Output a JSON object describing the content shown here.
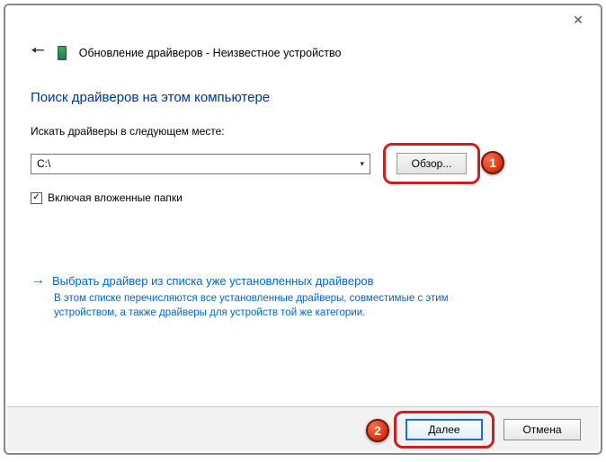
{
  "window": {
    "title": "Обновление драйверов - Неизвестное устройство"
  },
  "heading": "Поиск драйверов на этом компьютере",
  "form": {
    "search_label": "Искать драйверы в следующем месте:",
    "path_value": "C:\\",
    "browse_label": "Обзор...",
    "include_sub_label": "Включая вложенные папки",
    "include_sub_checked": true
  },
  "link": {
    "title": "Выбрать драйвер из списка уже установленных драйверов",
    "desc": "В этом списке перечисляются все установленные драйверы, совместимые с этим устройством, а также драйверы для устройств той же категории."
  },
  "footer": {
    "next_label": "Далее",
    "cancel_label": "Отмена"
  },
  "annotations": {
    "badge1": "1",
    "badge2": "2"
  }
}
